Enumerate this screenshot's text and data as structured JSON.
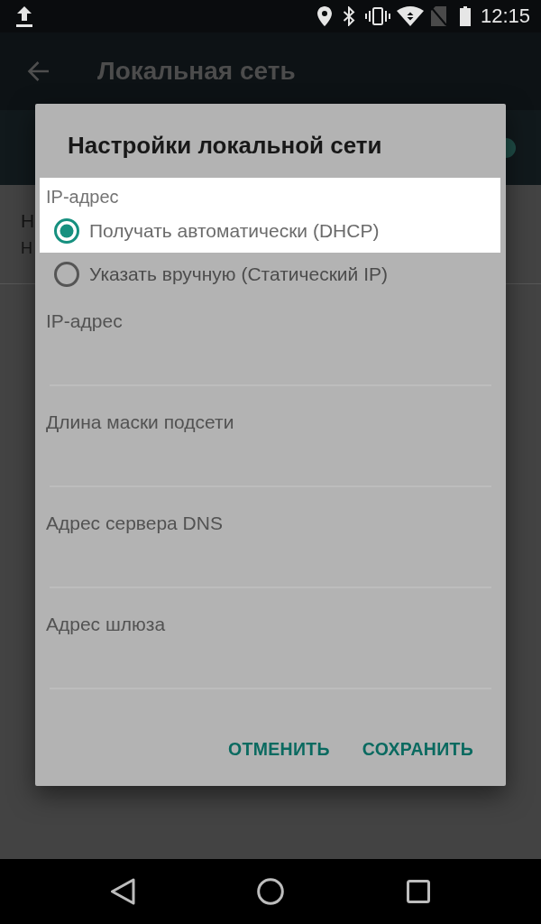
{
  "status_bar": {
    "time": "12:15"
  },
  "app_bar": {
    "title": "Локальная сеть"
  },
  "switch_bar": {
    "on": true
  },
  "list_item": {
    "title": "Н",
    "summary": "Н"
  },
  "dialog": {
    "title": "Настройки локальной сети",
    "ip_mode": {
      "label": "IP-адрес",
      "highlighted": true,
      "options": [
        {
          "label": "Получать автоматически (DHCP)",
          "selected": true,
          "highlighted": true
        },
        {
          "label": "Указать вручную (Статический IP)",
          "selected": false,
          "highlighted": false
        }
      ]
    },
    "fields": [
      {
        "label": "IP-адрес"
      },
      {
        "label": "Длина маски подсети"
      },
      {
        "label": "Адрес сервера DNS"
      },
      {
        "label": "Адрес шлюза"
      }
    ],
    "buttons": [
      {
        "label": "ОТМЕНИТЬ"
      },
      {
        "label": "СОХРАНИТЬ"
      }
    ]
  }
}
